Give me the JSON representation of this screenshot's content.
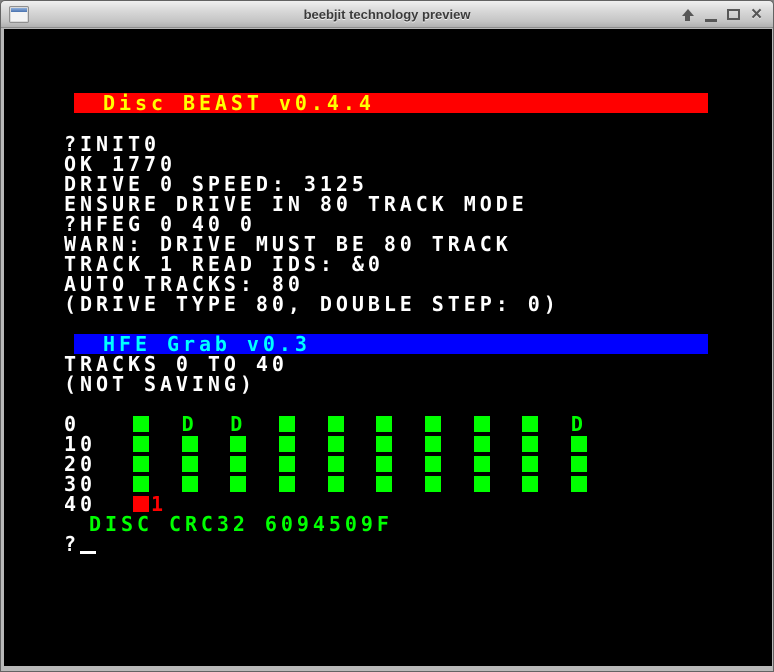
{
  "window": {
    "title": "beebjit technology preview"
  },
  "colors": {
    "red": "#ff0000",
    "blue": "#0000ff",
    "yellow": "#ffff00",
    "cyan": "#00ffff",
    "green": "#00ff00",
    "white": "#ffffff"
  },
  "terminal": {
    "disc_beast_banner": "Disc BEAST v0.4.4",
    "boot_lines": [
      "?INIT0",
      "OK 1770",
      "DRIVE 0 SPEED: 3125",
      "ENSURE DRIVE IN 80 TRACK MODE",
      "?HFEG 0 40 0",
      "WARN: DRIVE MUST BE 80 TRACK",
      "TRACK 1 READ IDS: &0",
      "AUTO TRACKS: 80",
      "(DRIVE TYPE 80, DOUBLE STEP: 0)"
    ],
    "hfe_grab_banner": "HFE Grab v0.3",
    "grab_lines": [
      "TRACKS 0 TO 40",
      "(NOT SAVING)"
    ],
    "track_grid": {
      "rows": [
        {
          "label": "0",
          "cells": [
            "block",
            "D",
            "D",
            "block",
            "block",
            "block",
            "block",
            "block",
            "block",
            "D"
          ]
        },
        {
          "label": "10",
          "cells": [
            "block",
            "block",
            "block",
            "block",
            "block",
            "block",
            "block",
            "block",
            "block",
            "block"
          ]
        },
        {
          "label": "20",
          "cells": [
            "block",
            "block",
            "block",
            "block",
            "block",
            "block",
            "block",
            "block",
            "block",
            "block"
          ]
        },
        {
          "label": "30",
          "cells": [
            "block",
            "block",
            "block",
            "block",
            "block",
            "block",
            "block",
            "block",
            "block",
            "block"
          ]
        },
        {
          "label": "40",
          "cells": [
            "error",
            "",
            "",
            "",
            "",
            "",
            "",
            "",
            "",
            ""
          ]
        }
      ],
      "error_marker": "1"
    },
    "crc_line": "DISC CRC32 6094509F",
    "prompt": "?",
    "cursor": "_"
  }
}
